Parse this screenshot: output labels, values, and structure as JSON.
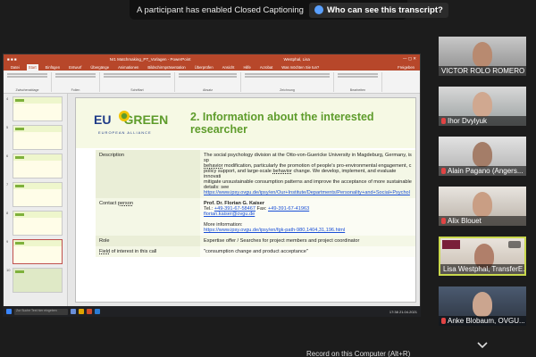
{
  "caption_banner": {
    "text": "A participant has enabled Closed Captioning",
    "button_label": "Who can see this transcript?"
  },
  "powerpoint": {
    "window_title": "Nr1 Matchmaking_PT_Vorlagen - PowerPoint",
    "user": "Westphal, Lisa",
    "share_label": "Freigeben",
    "tabs": [
      "Datei",
      "Start",
      "Einfügen",
      "Entwurf",
      "Übergänge",
      "Animationen",
      "Bildschirmpräsentation",
      "Überprüfen",
      "Ansicht",
      "Hilfe",
      "Acrobat",
      "Was möchten Sie tun?"
    ],
    "ribbon_groups": [
      "Zwischenablage",
      "Folien",
      "Schriftart",
      "Absatz",
      "Zeichnung",
      "Bearbeiten"
    ],
    "thumbnail_numbers": [
      "4",
      "5",
      "6",
      "7",
      "8",
      "9",
      "10"
    ],
    "notes_placeholder": "Klicken Sie, um Notizen hinzuzufügen",
    "taskbar_search": "Zur Suche Text hier eingeben",
    "clock": "17:38 21.04.2021"
  },
  "slide": {
    "logo_eu": "EU",
    "logo_green": "GREEN",
    "logo_sub": "EUROPEAN ALLIANCE",
    "title": "2. Information about the interested researcher",
    "rows": {
      "description": {
        "label": "Description",
        "text1": "The social psychology division at the Otto-von-Guericke University in Magdeburg, Germany, is sp",
        "text2": "behavior",
        "text3": " modification, particularly the promotion of people's pro-environmental engagement, c",
        "text4": "policy support, and large-scale ",
        "text5": "behavior",
        "text6": " change. We develop, implement, and evaluate innovati",
        "text7": "mitigate unsustainable consumption patterns and improve the acceptance of more sustainable",
        "text8": "details: see",
        "link": "https://www.ipsy.ovgu.de/ipsy/en/Our+Institute/Departments/Personality+and+Social+Psychol"
      },
      "contact": {
        "label_a": "Contact ",
        "label_b": "person",
        "name": "Prof. Dr. Florian G. Kaiser",
        "tel_label": "Tel.: ",
        "tel": "+49-391-67-58467",
        "fax_label": " Fax: ",
        "fax": "+49-391-67-41963",
        "email": "florian.kaiser@ovgu.de",
        "more": "More information:",
        "more_link": "https://www.ipsy.ovgu.de/ipsy/en/fgk-path-980,1404,31,196.html"
      },
      "role": {
        "label": "Role",
        "text": "Expertise offer / Searches for project members and project coordinator"
      },
      "field": {
        "label_a": "Field",
        "label_b": " of interest in this call",
        "text": "\"consumption change and product acceptance\""
      }
    }
  },
  "participants": [
    {
      "name": "VICTOR ROLO ROMERO",
      "muted": false
    },
    {
      "name": "Ihor Dvylyuk",
      "muted": true
    },
    {
      "name": "Alain Pagano (Angers...",
      "muted": true
    },
    {
      "name": "Alix Blouet",
      "muted": true
    },
    {
      "name": "Lisa Westphal, TransferE...",
      "muted": false
    },
    {
      "name": "Anke Blobaum, OVGU...",
      "muted": true
    }
  ],
  "bottom_hint": "Record on this Computer (Alt+R)",
  "colors": {
    "accent_green": "#5e9c2b",
    "eu_blue": "#1f3c88",
    "ppt_red": "#b7472a",
    "active_speaker": "#c9d84d"
  }
}
